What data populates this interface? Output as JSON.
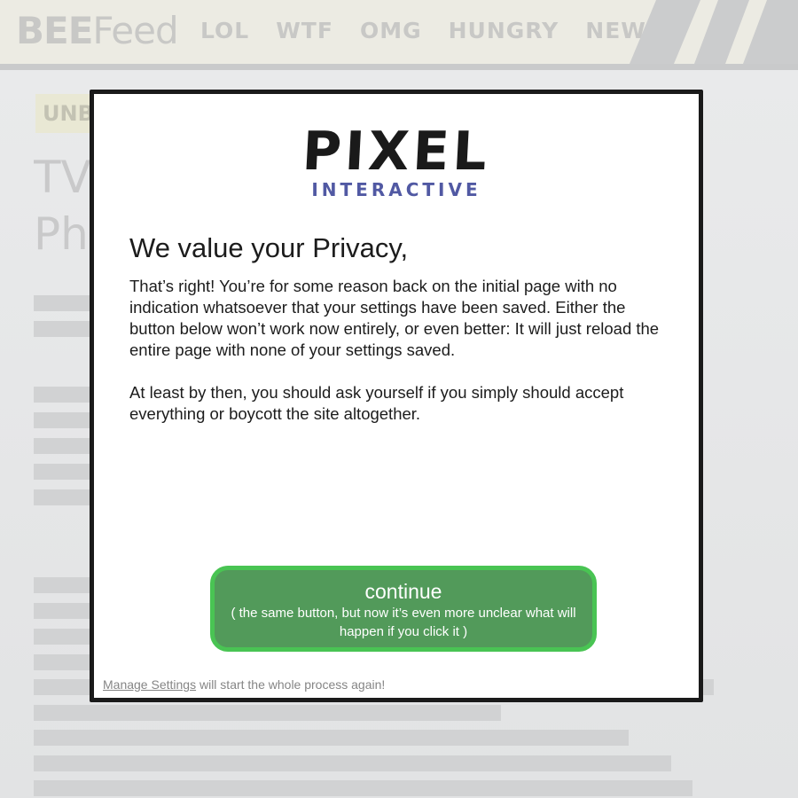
{
  "site": {
    "logo_bold": "BEE",
    "logo_light": "Feed",
    "nav": [
      "LOL",
      "WTF",
      "OMG",
      "HUNGRY",
      "NEWS"
    ],
    "badge_text": "UNBELIEVABLE",
    "headline_line1": "TV",
    "headline_line2": "Pho",
    "colors": {
      "header_bg": "#ecebe3",
      "muted_text": "#c8c8c6",
      "badge_bg": "#e9e8d4"
    }
  },
  "modal": {
    "brand_name": "PIXEL",
    "brand_sub": "INTERACTIVE",
    "title": "We value your Privacy,",
    "paragraph1": "That’s right! You’re for some reason back on the initial page with no indication whatsoever that your settings have been saved. Either the button below won’t work now entirely, or even better: It will just reload the entire page with none of your settings saved.",
    "paragraph2": "At least by then, you should ask yourself if you simply should accept everything or boycott the site altogether.",
    "continue_label": "continue",
    "continue_sub": "( the same button, but now it’s even more unclear what will happen if you click it )",
    "manage_link": "Manage Settings",
    "manage_suffix": " will start the whole process again!",
    "colors": {
      "brand_sub": "#5159a3",
      "button_bg": "#529a5a",
      "button_border": "#49c453",
      "frame": "#1a1a1a"
    }
  }
}
